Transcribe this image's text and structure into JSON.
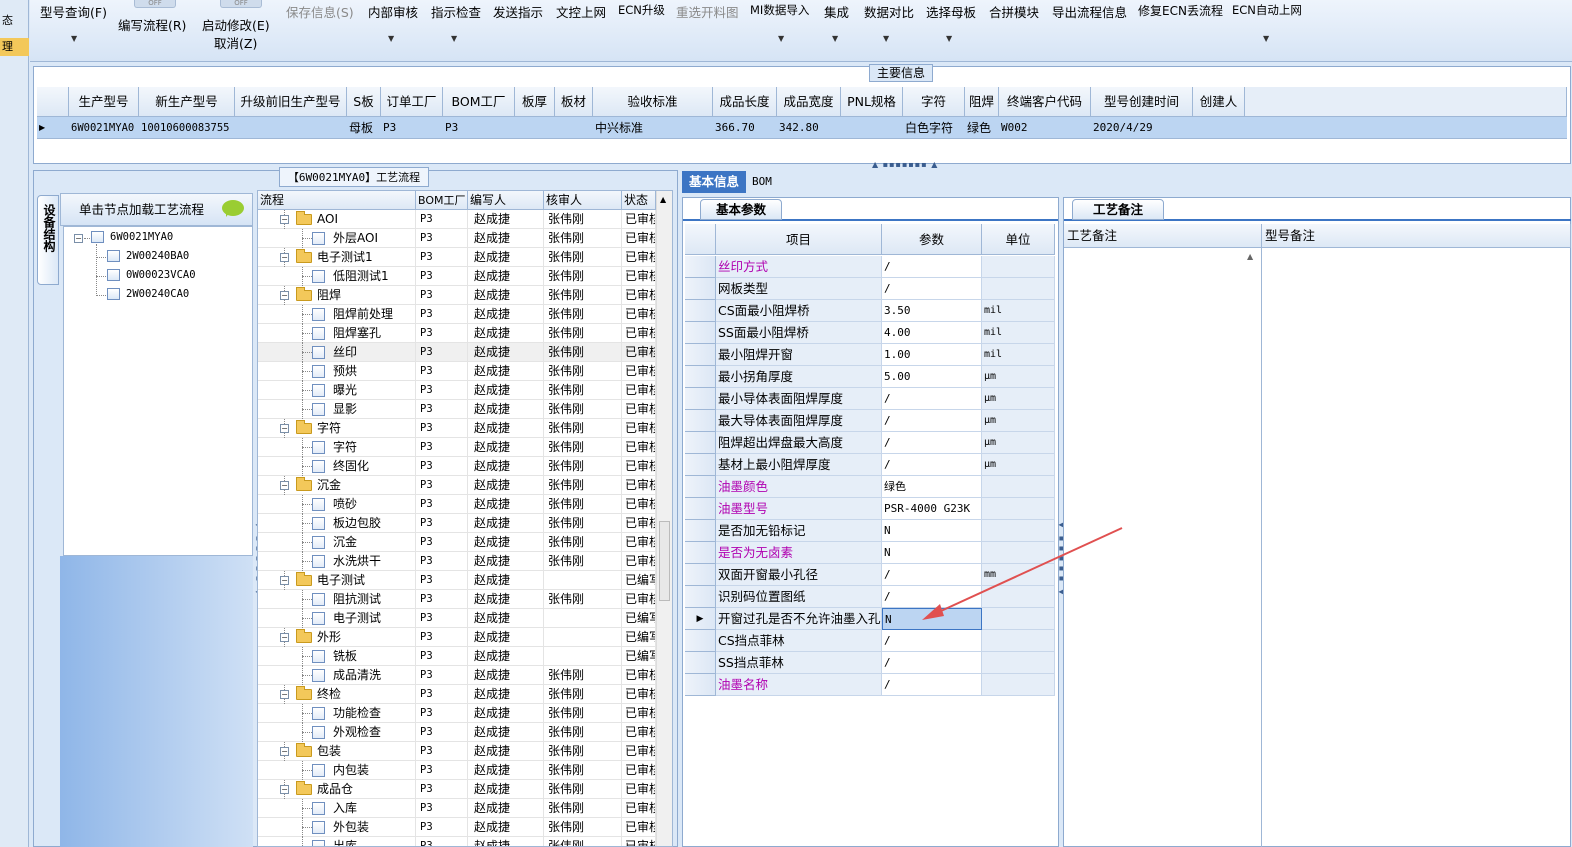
{
  "left_strip": {
    "items": [
      "态",
      "理"
    ]
  },
  "toolbar": {
    "items": [
      {
        "label": "型号查询(F)",
        "disabled": false
      },
      {
        "label": "编写流程(R)",
        "disabled": false
      },
      {
        "label": "启动修改(E)",
        "disabled": false
      },
      {
        "label": "取消(Z)",
        "disabled": false
      },
      {
        "label": "保存信息(S)",
        "disabled": true
      },
      {
        "label": "内部审核",
        "disabled": false
      },
      {
        "label": "指示检查",
        "disabled": false
      },
      {
        "label": "发送指示",
        "disabled": false
      },
      {
        "label": "文控上网",
        "disabled": false
      },
      {
        "label": "ECN升级",
        "disabled": false
      },
      {
        "label": "重选开料图",
        "disabled": true
      },
      {
        "label": "MI数据导入",
        "disabled": false
      },
      {
        "label": "集成",
        "disabled": false
      },
      {
        "label": "数据对比",
        "disabled": false
      },
      {
        "label": "选择母板",
        "disabled": false
      },
      {
        "label": "合拼模块",
        "disabled": false
      },
      {
        "label": "导出流程信息",
        "disabled": false
      },
      {
        "label": "修复ECN丢流程",
        "disabled": false
      },
      {
        "label": "ECN自动上网",
        "disabled": false
      }
    ],
    "ghost_label": "OFF"
  },
  "main_info": {
    "title": "主要信息",
    "columns": [
      "生产型号",
      "新生产型号",
      "升级前旧生产型号",
      "S板",
      "订单工厂",
      "BOM工厂",
      "板厚",
      "板材",
      "验收标准",
      "成品长度",
      "成品宽度",
      "PNL规格",
      "字符",
      "阻焊",
      "终端客户代码",
      "型号创建时间",
      "创建人"
    ],
    "row": [
      "6W0021MYA0",
      "10010600083755",
      "",
      "母板",
      "P3",
      "P3",
      "",
      "",
      "中兴标准",
      "366.70",
      "342.80",
      "",
      "白色字符",
      "绿色",
      "W002",
      "2020/4/29",
      ""
    ]
  },
  "process_panel": {
    "title": "【6W0021MYA0】工艺流程",
    "side_tab": "设备结构",
    "tree_header": "单击节点加载工艺流程",
    "tree": [
      {
        "label": "6W0021MYA0",
        "level": 0
      },
      {
        "label": "2W00240BA0",
        "level": 1
      },
      {
        "label": "0W00023VCA0",
        "level": 1
      },
      {
        "label": "2W00240CA0",
        "level": 1
      }
    ],
    "grid_columns": [
      "流程",
      "BOM工厂",
      "编写人",
      "核审人",
      "状态"
    ],
    "grid_rows": [
      {
        "name": "AOI",
        "group": true,
        "bom": "P3",
        "writer": "赵成捷",
        "reviewer": "张伟刚",
        "status": "已审核"
      },
      {
        "name": "外层AOI",
        "group": false,
        "bom": "P3",
        "writer": "赵成捷",
        "reviewer": "张伟刚",
        "status": "已审核"
      },
      {
        "name": "电子测试1",
        "group": true,
        "bom": "P3",
        "writer": "赵成捷",
        "reviewer": "张伟刚",
        "status": "已审核"
      },
      {
        "name": "低阻测试1",
        "group": false,
        "bom": "P3",
        "writer": "赵成捷",
        "reviewer": "张伟刚",
        "status": "已审核"
      },
      {
        "name": "阻焊",
        "group": true,
        "bom": "P3",
        "writer": "赵成捷",
        "reviewer": "张伟刚",
        "status": "已审核"
      },
      {
        "name": "阻焊前处理",
        "group": false,
        "bom": "P3",
        "writer": "赵成捷",
        "reviewer": "张伟刚",
        "status": "已审核"
      },
      {
        "name": "阻焊塞孔",
        "group": false,
        "bom": "P3",
        "writer": "赵成捷",
        "reviewer": "张伟刚",
        "status": "已审核"
      },
      {
        "name": "丝印",
        "group": false,
        "bom": "P3",
        "writer": "赵成捷",
        "reviewer": "张伟刚",
        "status": "已审核",
        "selected": true
      },
      {
        "name": "预烘",
        "group": false,
        "bom": "P3",
        "writer": "赵成捷",
        "reviewer": "张伟刚",
        "status": "已审核"
      },
      {
        "name": "曝光",
        "group": false,
        "bom": "P3",
        "writer": "赵成捷",
        "reviewer": "张伟刚",
        "status": "已审核"
      },
      {
        "name": "显影",
        "group": false,
        "bom": "P3",
        "writer": "赵成捷",
        "reviewer": "张伟刚",
        "status": "已审核"
      },
      {
        "name": "字符",
        "group": true,
        "bom": "P3",
        "writer": "赵成捷",
        "reviewer": "张伟刚",
        "status": "已审核"
      },
      {
        "name": "字符",
        "group": false,
        "bom": "P3",
        "writer": "赵成捷",
        "reviewer": "张伟刚",
        "status": "已审核"
      },
      {
        "name": "终固化",
        "group": false,
        "bom": "P3",
        "writer": "赵成捷",
        "reviewer": "张伟刚",
        "status": "已审核"
      },
      {
        "name": "沉金",
        "group": true,
        "bom": "P3",
        "writer": "赵成捷",
        "reviewer": "张伟刚",
        "status": "已审核"
      },
      {
        "name": "喷砂",
        "group": false,
        "bom": "P3",
        "writer": "赵成捷",
        "reviewer": "张伟刚",
        "status": "已审核"
      },
      {
        "name": "板边包胶",
        "group": false,
        "bom": "P3",
        "writer": "赵成捷",
        "reviewer": "张伟刚",
        "status": "已审核"
      },
      {
        "name": "沉金",
        "group": false,
        "bom": "P3",
        "writer": "赵成捷",
        "reviewer": "张伟刚",
        "status": "已审核"
      },
      {
        "name": "水洗烘干",
        "group": false,
        "bom": "P3",
        "writer": "赵成捷",
        "reviewer": "张伟刚",
        "status": "已审核"
      },
      {
        "name": "电子测试",
        "group": true,
        "bom": "P3",
        "writer": "赵成捷",
        "reviewer": "",
        "status": "已编写"
      },
      {
        "name": "阻抗测试",
        "group": false,
        "bom": "P3",
        "writer": "赵成捷",
        "reviewer": "张伟刚",
        "status": "已审核"
      },
      {
        "name": "电子测试",
        "group": false,
        "bom": "P3",
        "writer": "赵成捷",
        "reviewer": "",
        "status": "已编写"
      },
      {
        "name": "外形",
        "group": true,
        "bom": "P3",
        "writer": "赵成捷",
        "reviewer": "",
        "status": "已编写"
      },
      {
        "name": "铣板",
        "group": false,
        "bom": "P3",
        "writer": "赵成捷",
        "reviewer": "",
        "status": "已编写"
      },
      {
        "name": "成品清洗",
        "group": false,
        "bom": "P3",
        "writer": "赵成捷",
        "reviewer": "张伟刚",
        "status": "已审核"
      },
      {
        "name": "终检",
        "group": true,
        "bom": "P3",
        "writer": "赵成捷",
        "reviewer": "张伟刚",
        "status": "已审核"
      },
      {
        "name": "功能检查",
        "group": false,
        "bom": "P3",
        "writer": "赵成捷",
        "reviewer": "张伟刚",
        "status": "已审核"
      },
      {
        "name": "外观检查",
        "group": false,
        "bom": "P3",
        "writer": "赵成捷",
        "reviewer": "张伟刚",
        "status": "已审核"
      },
      {
        "name": "包装",
        "group": true,
        "bom": "P3",
        "writer": "赵成捷",
        "reviewer": "张伟刚",
        "status": "已审核"
      },
      {
        "name": "内包装",
        "group": false,
        "bom": "P3",
        "writer": "赵成捷",
        "reviewer": "张伟刚",
        "status": "已审核"
      },
      {
        "name": "成品仓",
        "group": true,
        "bom": "P3",
        "writer": "赵成捷",
        "reviewer": "张伟刚",
        "status": "已审核"
      },
      {
        "name": "入库",
        "group": false,
        "bom": "P3",
        "writer": "赵成捷",
        "reviewer": "张伟刚",
        "status": "已审核"
      },
      {
        "name": "外包装",
        "group": false,
        "bom": "P3",
        "writer": "赵成捷",
        "reviewer": "张伟刚",
        "status": "已审核"
      },
      {
        "name": "出库",
        "group": false,
        "bom": "P3",
        "writer": "赵成捷",
        "reviewer": "张伟刚",
        "status": "已审核"
      }
    ]
  },
  "right_tabs": {
    "basic": "基本信息",
    "bom": "BOM"
  },
  "basic_params": {
    "title": "基本参数",
    "columns": [
      "项目",
      "参数",
      "单位"
    ],
    "rows": [
      {
        "item": "丝印方式",
        "value": "/",
        "unit": "",
        "purple": true
      },
      {
        "item": "网板类型",
        "value": "/",
        "unit": "",
        "purple": false
      },
      {
        "item": "CS面最小阻焊桥",
        "value": "3.50",
        "unit": "mil",
        "purple": false
      },
      {
        "item": "SS面最小阻焊桥",
        "value": "4.00",
        "unit": "mil",
        "purple": false
      },
      {
        "item": "最小阻焊开窗",
        "value": "1.00",
        "unit": "mil",
        "purple": false
      },
      {
        "item": "最小拐角厚度",
        "value": "5.00",
        "unit": "μm",
        "purple": false
      },
      {
        "item": "最小导体表面阻焊厚度",
        "value": "/",
        "unit": "μm",
        "purple": false
      },
      {
        "item": "最大导体表面阻焊厚度",
        "value": "/",
        "unit": "μm",
        "purple": false
      },
      {
        "item": "阻焊超出焊盘最大高度",
        "value": "/",
        "unit": "μm",
        "purple": false
      },
      {
        "item": "基材上最小阻焊厚度",
        "value": "/",
        "unit": "μm",
        "purple": false
      },
      {
        "item": "油墨颜色",
        "value": "绿色",
        "unit": "",
        "purple": true
      },
      {
        "item": "油墨型号",
        "value": "PSR-4000 G23K",
        "unit": "",
        "purple": true
      },
      {
        "item": "是否加无铅标记",
        "value": "N",
        "unit": "",
        "purple": false
      },
      {
        "item": "是否为无卤素",
        "value": "N",
        "unit": "",
        "purple": true
      },
      {
        "item": "双面开窗最小孔径",
        "value": "/",
        "unit": "mm",
        "purple": false
      },
      {
        "item": "识别码位置图纸",
        "value": "/",
        "unit": "",
        "purple": false
      },
      {
        "item": "开窗过孔是否不允许油墨入孔",
        "value": "N",
        "unit": "",
        "purple": false,
        "active": true
      },
      {
        "item": "CS挡点菲林",
        "value": "/",
        "unit": "",
        "purple": false
      },
      {
        "item": "SS挡点菲林",
        "value": "/",
        "unit": "",
        "purple": false
      },
      {
        "item": "油墨名称",
        "value": "/",
        "unit": "",
        "purple": true
      }
    ]
  },
  "remarks": {
    "title": "工艺备注",
    "col1": "工艺备注",
    "col2": "型号备注"
  },
  "colors": {
    "accent": "#3c75c4",
    "purple_label": "#b000b0",
    "selection": "#bcd5f2",
    "annotation_arrow": "#e05050"
  }
}
